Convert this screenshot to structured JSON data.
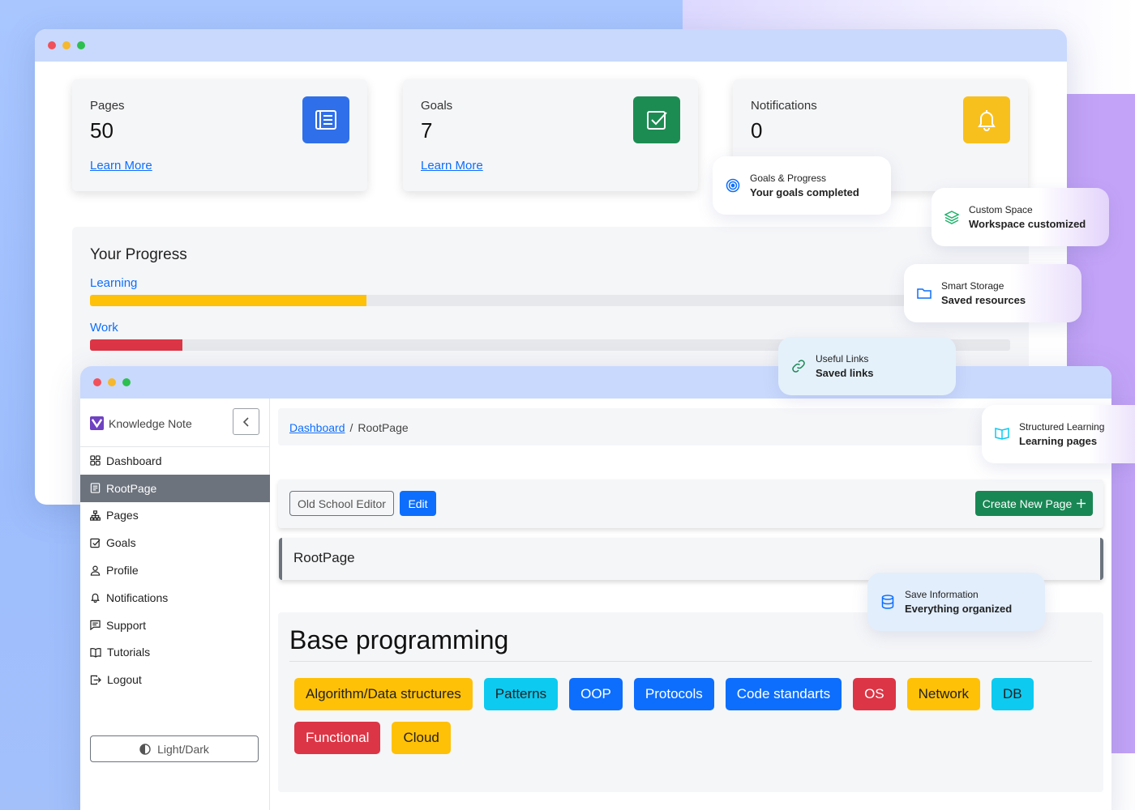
{
  "colors": {
    "primary": "#0d6efd",
    "success": "#198754",
    "warning": "#ffc107",
    "danger": "#dc3545",
    "info": "#0dcaf0",
    "secondary": "#6c737d"
  },
  "stats": [
    {
      "label": "Pages",
      "value": "50",
      "link": "Learn More",
      "icon": "document-list-icon",
      "color": "#2f6fe9"
    },
    {
      "label": "Goals",
      "value": "7",
      "link": "Learn More",
      "icon": "checkbox-icon",
      "color": "#1d8c53"
    },
    {
      "label": "Notifications",
      "value": "0",
      "icon": "bell-icon",
      "color": "#f8c01d"
    }
  ],
  "progress": {
    "title": "Your Progress",
    "items": [
      {
        "label": "Learning",
        "fraction": 0.3,
        "color": "#ffc107"
      },
      {
        "label": "Work",
        "fraction": 0.1,
        "color": "#dc3545"
      }
    ]
  },
  "sidebar": {
    "brand": "Knowledge Note",
    "items": [
      {
        "label": "Dashboard",
        "icon": "grid-icon"
      },
      {
        "label": "RootPage",
        "icon": "file-icon",
        "active": true
      },
      {
        "label": "Pages",
        "icon": "sitemap-icon"
      },
      {
        "label": "Goals",
        "icon": "check-square-icon"
      },
      {
        "label": "Profile",
        "icon": "person-icon"
      },
      {
        "label": "Notifications",
        "icon": "bell-icon"
      },
      {
        "label": "Support",
        "icon": "chat-icon"
      },
      {
        "label": "Tutorials",
        "icon": "book-icon"
      },
      {
        "label": "Logout",
        "icon": "logout-icon"
      }
    ],
    "theme_toggle": "Light/Dark"
  },
  "breadcrumb": {
    "root": "Dashboard",
    "separator": "/",
    "current": "RootPage"
  },
  "toolbar": {
    "old_editor": "Old School Editor",
    "edit": "Edit",
    "create": "Create New Page"
  },
  "page_title": "RootPage",
  "content": {
    "heading": "Base programming",
    "tags": [
      {
        "label": "Algorithm/Data structures",
        "color": "#ffc107",
        "text": "#222"
      },
      {
        "label": "Patterns",
        "color": "#0dcaf0",
        "text": "#222"
      },
      {
        "label": "OOP",
        "color": "#0d6efd",
        "text": "#fff"
      },
      {
        "label": "Protocols",
        "color": "#0d6efd",
        "text": "#fff"
      },
      {
        "label": "Code standarts",
        "color": "#0d6efd",
        "text": "#fff"
      },
      {
        "label": "OS",
        "color": "#dc3545",
        "text": "#fff"
      },
      {
        "label": "Network",
        "color": "#ffc107",
        "text": "#222"
      },
      {
        "label": "DB",
        "color": "#0dcaf0",
        "text": "#222"
      },
      {
        "label": "Functional",
        "color": "#dc3545",
        "text": "#fff"
      },
      {
        "label": "Cloud",
        "color": "#ffc107",
        "text": "#222"
      }
    ]
  },
  "floats": [
    {
      "title": "Goals & Progress",
      "subtitle": "Your goals completed",
      "icon": "target-icon"
    },
    {
      "title": "Custom Space",
      "subtitle": "Workspace customized",
      "icon": "layers-icon"
    },
    {
      "title": "Smart Storage",
      "subtitle": "Saved resources",
      "icon": "folder-icon"
    },
    {
      "title": "Useful Links",
      "subtitle": "Saved links",
      "icon": "link-icon"
    },
    {
      "title": "Structured Learning",
      "subtitle": "Learning pages",
      "icon": "open-book-icon"
    },
    {
      "title": "Save Information",
      "subtitle": "Everything organized",
      "icon": "database-icon"
    }
  ]
}
